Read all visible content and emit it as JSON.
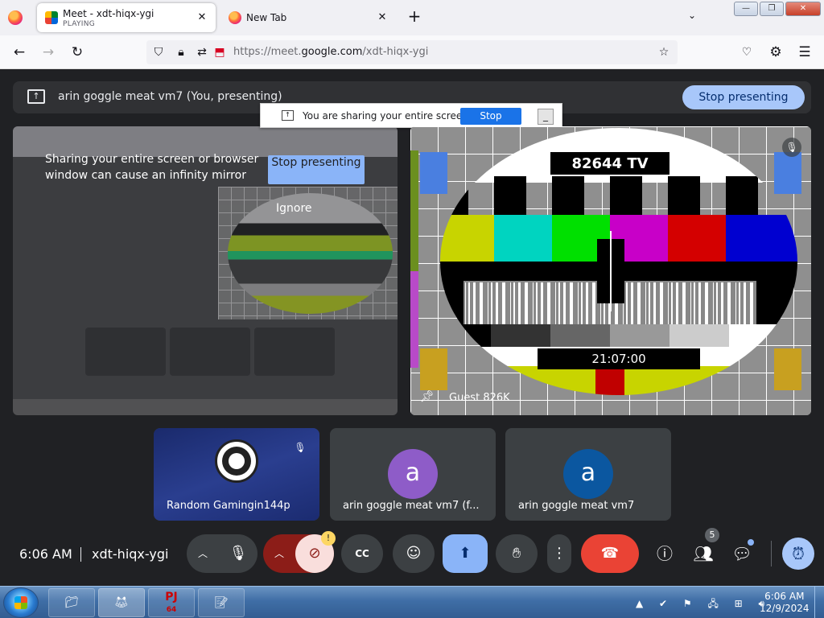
{
  "browser": {
    "tabs": [
      {
        "title": "Meet - xdt-hiqx-ygi",
        "status": "PLAYING",
        "close": "✕"
      },
      {
        "title": "New Tab",
        "close": "✕"
      }
    ],
    "new_tab": "+",
    "tab_list": "⌄",
    "window_buttons": {
      "minimize": "—",
      "maximize": "❐",
      "close": "✕"
    },
    "url": {
      "prefix": "https://meet.",
      "domain": "google.com",
      "path": "/xdt-hiqx-ygi"
    }
  },
  "presenting_bar": {
    "text": "arin goggle meat vm7 (You, presenting)",
    "stop_label": "Stop presenting"
  },
  "share_infobar": {
    "text": "You are sharing your entire screen.",
    "stop_label": "Stop Sharing",
    "minimize": "_"
  },
  "self_tile": {
    "warning": "Sharing your entire screen or browser window can cause an infinity mirror",
    "stop_label": "Stop presenting",
    "ignore_label": "Ignore"
  },
  "guest_tile": {
    "name": "Guest 826K",
    "pattern_title": "82644 TV",
    "pattern_time": "21:07:00"
  },
  "participants": [
    {
      "name": "Random Gamingin144p",
      "kind": "obs"
    },
    {
      "name": "arin goggle meat vm7 (f...",
      "initial": "a",
      "color": "#8e5cc8"
    },
    {
      "name": "arin goggle meat vm7",
      "initial": "a",
      "color": "#0b57a0"
    }
  ],
  "controls": {
    "time": "6:06 AM",
    "meeting_code": "xdt-hiqx-ygi",
    "people_count": "5",
    "camera_alert": "!"
  },
  "taskbar": {
    "time": "6:06 AM",
    "date": "12/9/2024",
    "pj_label": "PJ",
    "pj_sub": "64"
  },
  "colors": {
    "accent": "#a8c7fa",
    "hangup": "#ea4335",
    "share_active": "#8ab4f8",
    "camera_off": "#f9dedc"
  }
}
